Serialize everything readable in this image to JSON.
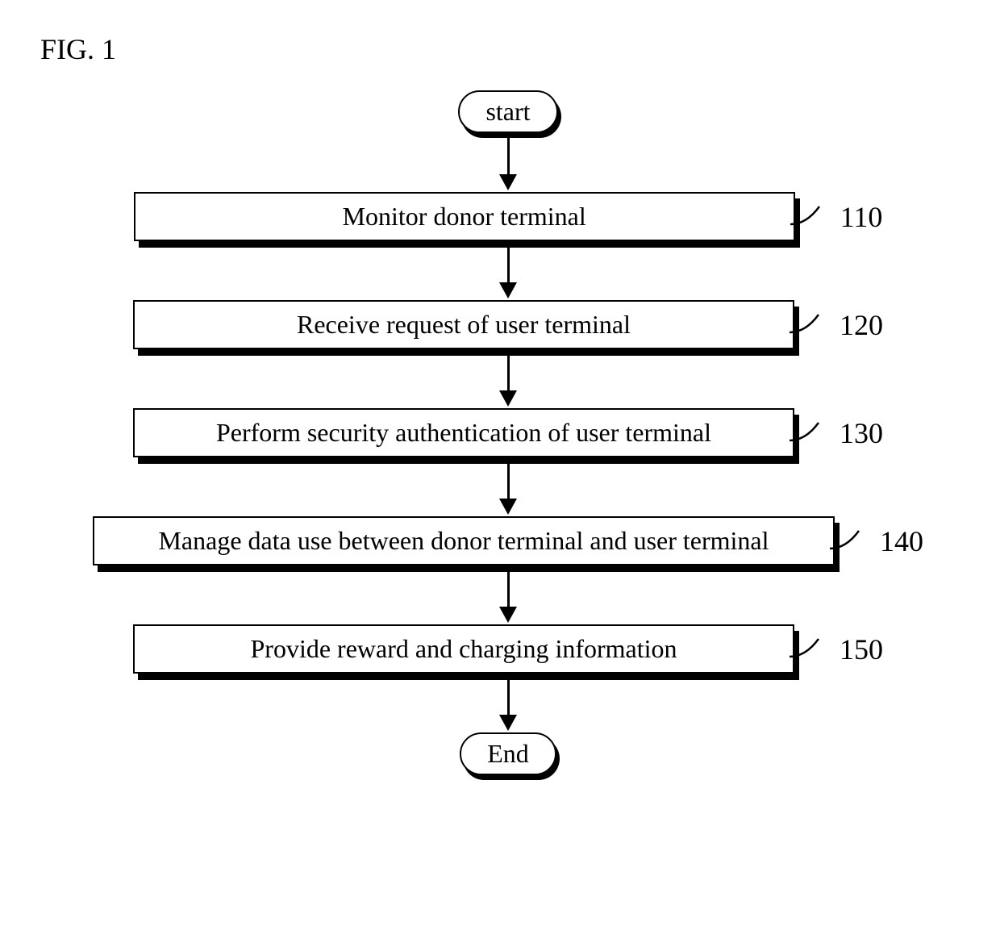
{
  "figure_label": "FIG. 1",
  "start_label": "start",
  "end_label": "End",
  "steps": [
    {
      "text": "Monitor donor terminal",
      "num": "110",
      "wide": false
    },
    {
      "text": "Receive request of user terminal",
      "num": "120",
      "wide": false
    },
    {
      "text": "Perform security authentication of user terminal",
      "num": "130",
      "wide": false
    },
    {
      "text": "Manage data use between donor terminal and user terminal",
      "num": "140",
      "wide": true
    },
    {
      "text": "Provide reward and charging information",
      "num": "150",
      "wide": false
    }
  ]
}
